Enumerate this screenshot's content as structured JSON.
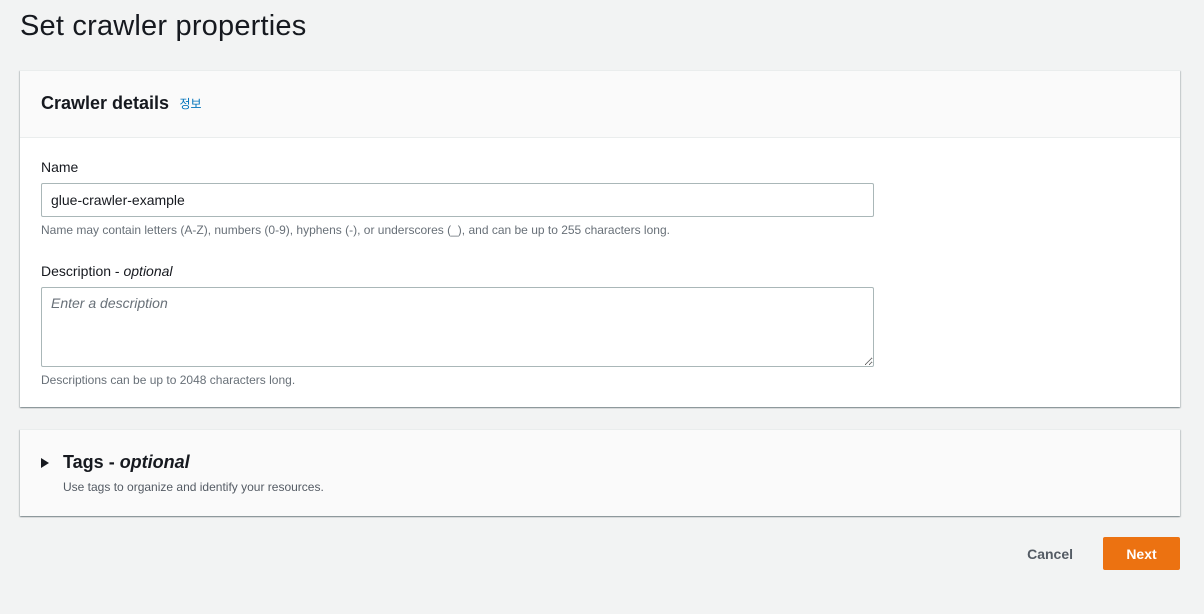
{
  "page": {
    "title": "Set crawler properties"
  },
  "crawler_details": {
    "header_title": "Crawler details",
    "info_link": "정보",
    "name": {
      "label": "Name",
      "value": "glue-crawler-example",
      "hint": "Name may contain letters (A-Z), numbers (0-9), hyphens (-), or underscores (_), and can be up to 255 characters long."
    },
    "description": {
      "label": "Description",
      "label_suffix_sep": " - ",
      "label_optional": "optional",
      "placeholder": "Enter a description",
      "value": "",
      "hint": "Descriptions can be up to 2048 characters long."
    }
  },
  "tags": {
    "title": "Tags",
    "title_sep": " - ",
    "title_optional": "optional",
    "description": "Use tags to organize and identify your resources.",
    "expanded": false
  },
  "actions": {
    "cancel_label": "Cancel",
    "next_label": "Next"
  },
  "colors": {
    "primary_button": "#ec7211",
    "link": "#0073bb",
    "background": "#f2f3f3"
  }
}
